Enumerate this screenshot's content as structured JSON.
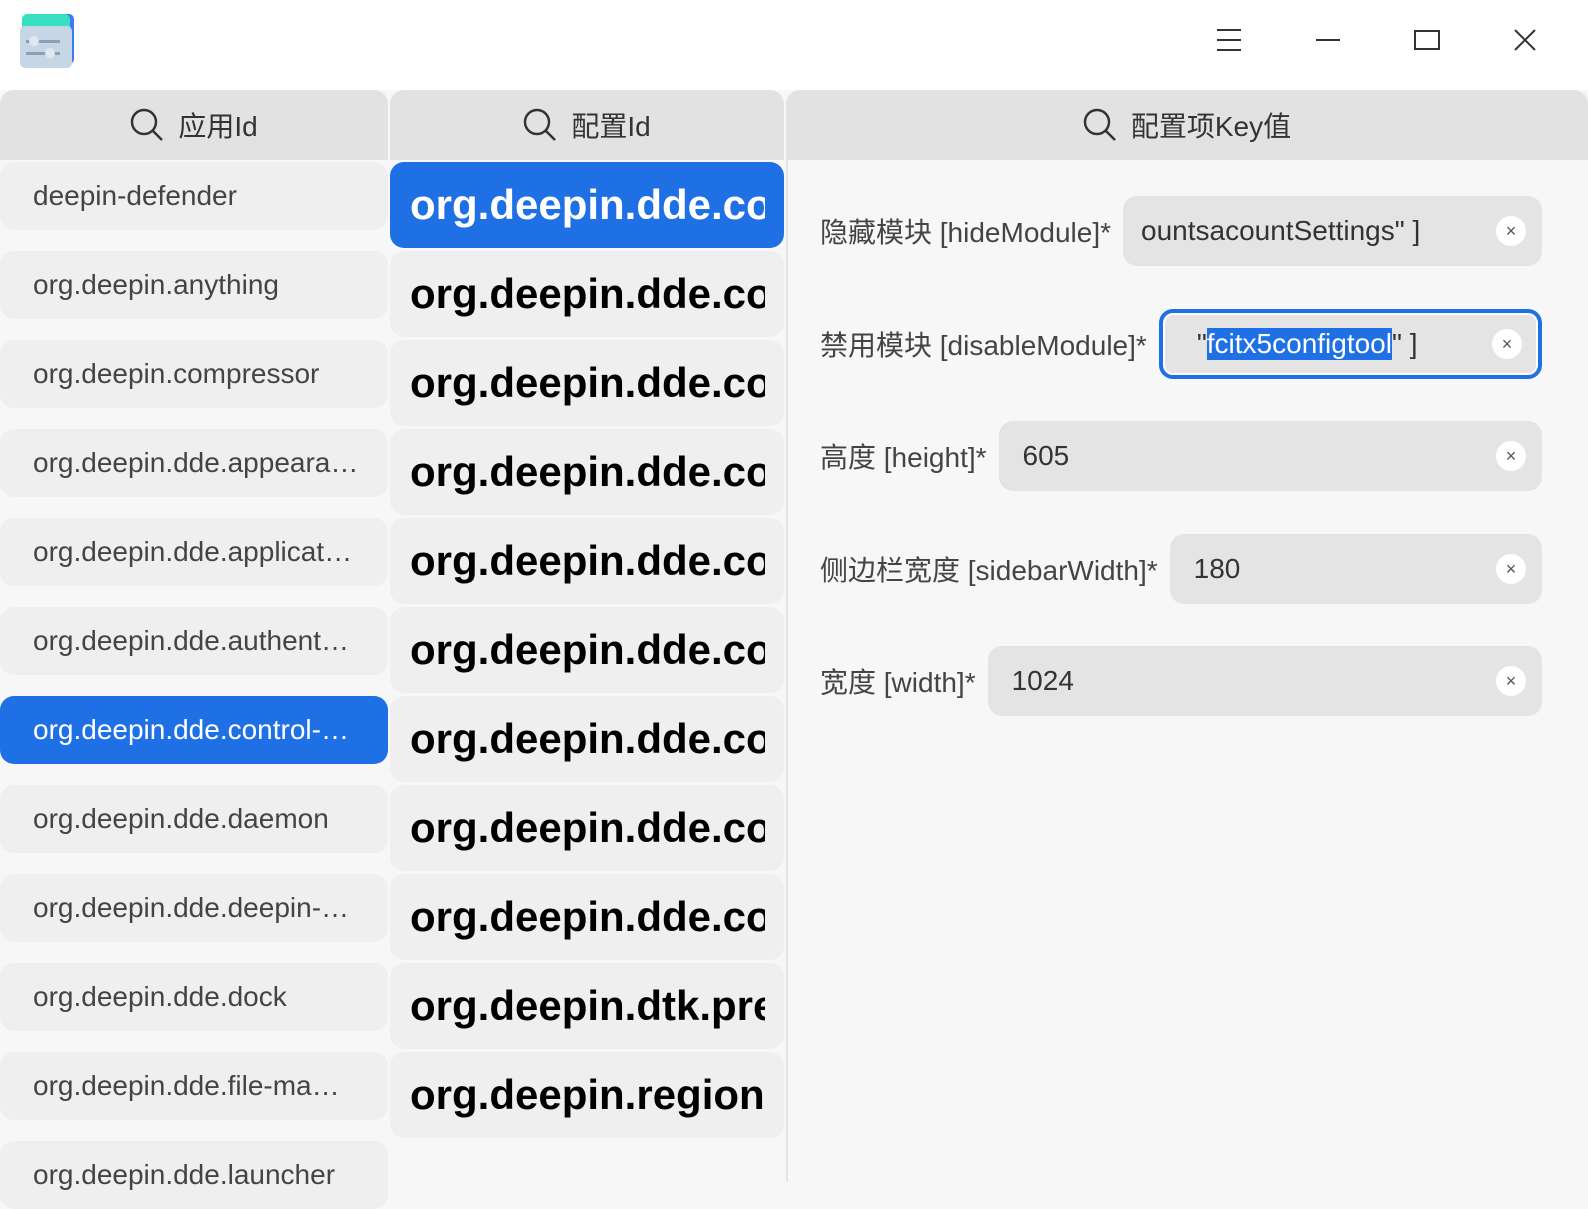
{
  "window": {
    "controls": [
      "menu-icon",
      "minimize-icon",
      "maximize-icon",
      "close-icon"
    ]
  },
  "headers": {
    "app_id": "应用Id",
    "config_id": "配置Id",
    "key": "配置项Key值"
  },
  "apps": [
    "deepin-defender",
    "org.deepin.anything",
    "org.deepin.compressor",
    "org.deepin.dde.appeara…",
    "org.deepin.dde.applicat…",
    "org.deepin.dde.authent…",
    "org.deepin.dde.control-…",
    "org.deepin.dde.daemon",
    "org.deepin.dde.deepin-…",
    "org.deepin.dde.dock",
    "org.deepin.dde.file-ma…",
    "org.deepin.dde.launcher"
  ],
  "selected_app": 6,
  "configs": [
    "org.deepin.dde.control-center",
    "org.deepin.dde.control-center",
    "org.deepin.dde.control-center",
    "org.deepin.dde.control-center",
    "org.deepin.dde.control-center",
    "org.deepin.dde.control-center",
    "org.deepin.dde.control-center",
    "org.deepin.dde.control-center",
    "org.deepin.dde.control-center",
    "org.deepin.dtk.preference",
    "org.deepin.region-format"
  ],
  "selected_config": 0,
  "settings": [
    {
      "label": "隐藏模块 [hideModule]*",
      "value": "ountsacountSettings\" ]",
      "prefix": "",
      "selected": "",
      "suffix": ""
    },
    {
      "label": "禁用模块 [disableModule]*",
      "value": "",
      "prefix": "\"",
      "selected": "fcitx5configtool",
      "suffix": "\" ]"
    },
    {
      "label": "高度 [height]*",
      "value": "605"
    },
    {
      "label": "侧边栏宽度 [sidebarWidth]*",
      "value": "180"
    },
    {
      "label": "宽度 [width]*",
      "value": "1024"
    }
  ],
  "clear_glyph": "×",
  "colors": {
    "accent": "#1f6fe5"
  }
}
